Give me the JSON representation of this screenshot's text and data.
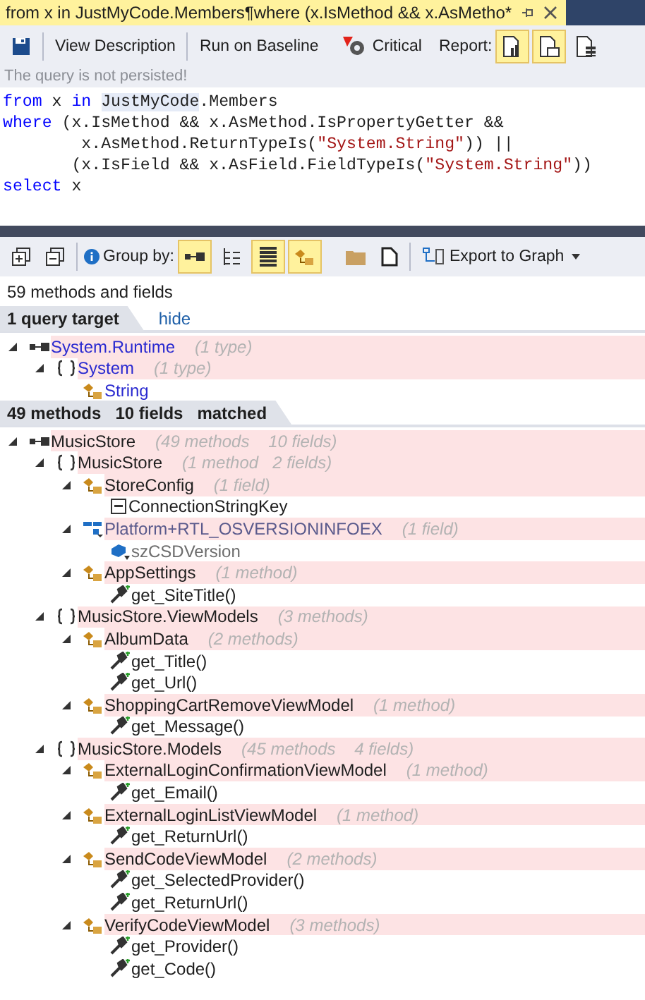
{
  "document_tab": {
    "title": "from x in JustMyCode.Members¶where (x.IsMethod && x.AsMetho*",
    "selected": true
  },
  "toolbar": {
    "view_description": "View Description",
    "run_on_baseline": "Run on Baseline",
    "critical": "Critical",
    "report_label": "Report:",
    "report_buttons": [
      {
        "selected": true
      },
      {
        "selected": true
      },
      {
        "selected": false
      }
    ]
  },
  "status_message": "The query is not persisted!",
  "code_lines": [
    [
      {
        "kind": "keyword",
        "text": "from"
      },
      {
        "kind": "plain",
        "text": " x "
      },
      {
        "kind": "keyword",
        "text": "in "
      },
      {
        "kind": "highlight",
        "text": "JustMyCode"
      },
      {
        "kind": "plain",
        "text": ".Members"
      }
    ],
    [
      {
        "kind": "keyword",
        "text": "where"
      },
      {
        "kind": "plain",
        "text": " (x.IsMethod && x.AsMethod.IsPropertyGetter &&"
      }
    ],
    [
      {
        "kind": "plain",
        "text": "        x.AsMethod.ReturnTypeIs("
      },
      {
        "kind": "string",
        "text": "\"System.String\""
      },
      {
        "kind": "plain",
        "text": ")) ||"
      }
    ],
    [
      {
        "kind": "plain",
        "text": "       (x.IsField && x.AsField.FieldTypeIs("
      },
      {
        "kind": "string",
        "text": "\"System.String\""
      },
      {
        "kind": "plain",
        "text": "))"
      }
    ],
    [
      {
        "kind": "keyword",
        "text": "select"
      },
      {
        "kind": "plain",
        "text": " x"
      }
    ]
  ],
  "results_toolbar": {
    "group_by_label": "Group by:",
    "group_buttons": [
      {
        "selected": true
      },
      {
        "selected": false
      },
      {
        "selected": true
      },
      {
        "selected": true
      }
    ],
    "export": "Export to Graph"
  },
  "summary": "59 methods and fields",
  "target_section": {
    "title": "1 query target",
    "link": "hide"
  },
  "target_tree": [
    {
      "kind": "assembly",
      "name": "System.Runtime",
      "count": "(1 type)",
      "third_party": true,
      "expanded": true,
      "children": [
        {
          "kind": "namespace",
          "name": "System",
          "count": "(1 type)",
          "third_party": true,
          "expanded": true,
          "children": [
            {
              "kind": "class",
              "name": "String",
              "third_party": true
            }
          ]
        }
      ]
    }
  ],
  "matched_section": {
    "title": "49 methods   10 fields   matched"
  },
  "matched_tree": [
    {
      "kind": "assembly",
      "name": "MusicStore",
      "count": "(49 methods    10 fields)",
      "expanded": true,
      "children": [
        {
          "kind": "namespace",
          "name": "MusicStore",
          "count": "(1 method   2 fields)",
          "expanded": true,
          "children": [
            {
              "kind": "class",
              "name": "StoreConfig",
              "count": "(1 field)",
              "expanded": true,
              "children": [
                {
                  "kind": "field",
                  "name": "ConnectionStringKey"
                }
              ]
            },
            {
              "kind": "struct",
              "name": "Platform+RTL_OSVERSIONINFOEX",
              "count": "(1 field)",
              "expanded": true,
              "children": [
                {
                  "kind": "struct_field",
                  "name": "szCSDVersion"
                }
              ]
            },
            {
              "kind": "class",
              "name": "AppSettings",
              "count": "(1 method)",
              "expanded": true,
              "children": [
                {
                  "kind": "method",
                  "name": "get_SiteTitle()"
                }
              ]
            }
          ]
        },
        {
          "kind": "namespace",
          "name": "MusicStore.ViewModels",
          "count": "(3 methods)",
          "expanded": true,
          "children": [
            {
              "kind": "class",
              "name": "AlbumData",
              "count": "(2 methods)",
              "expanded": true,
              "children": [
                {
                  "kind": "method",
                  "name": "get_Title()"
                },
                {
                  "kind": "method",
                  "name": "get_Url()"
                }
              ]
            },
            {
              "kind": "class",
              "name": "ShoppingCartRemoveViewModel",
              "count": "(1 method)",
              "expanded": true,
              "children": [
                {
                  "kind": "method",
                  "name": "get_Message()"
                }
              ]
            }
          ]
        },
        {
          "kind": "namespace",
          "name": "MusicStore.Models",
          "count": "(45 methods    4 fields)",
          "expanded": true,
          "children": [
            {
              "kind": "class",
              "name": "ExternalLoginConfirmationViewModel",
              "count": "(1 method)",
              "expanded": true,
              "children": [
                {
                  "kind": "method",
                  "name": "get_Email()"
                }
              ]
            },
            {
              "kind": "class",
              "name": "ExternalLoginListViewModel",
              "count": "(1 method)",
              "expanded": true,
              "children": [
                {
                  "kind": "method",
                  "name": "get_ReturnUrl()"
                }
              ]
            },
            {
              "kind": "class",
              "name": "SendCodeViewModel",
              "count": "(2 methods)",
              "expanded": true,
              "children": [
                {
                  "kind": "method",
                  "name": "get_SelectedProvider()"
                },
                {
                  "kind": "method",
                  "name": "get_ReturnUrl()"
                }
              ]
            },
            {
              "kind": "class",
              "name": "VerifyCodeViewModel",
              "count": "(3 methods)",
              "expanded": true,
              "children": [
                {
                  "kind": "method",
                  "name": "get_Provider()"
                },
                {
                  "kind": "method",
                  "name": "get_Code()"
                }
              ]
            }
          ]
        }
      ]
    }
  ]
}
